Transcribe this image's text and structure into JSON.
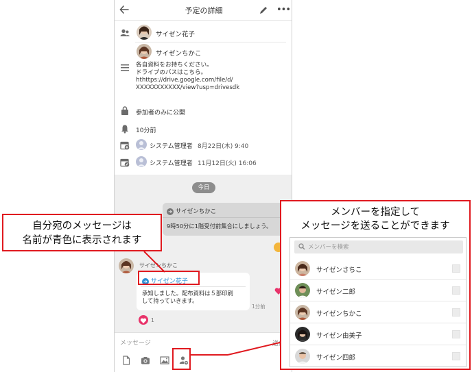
{
  "header": {
    "title": "予定の詳細"
  },
  "participants": [
    {
      "name": "サイゼン花子"
    },
    {
      "name": "サイゼンちかこ"
    }
  ],
  "description": {
    "lines": [
      "各自資料をお持ちください。",
      "ドライブのバスはこちら。",
      " hthttps://drive.google.com/file/d/",
      "XXXXXXXXXXX/view?usp=drivesdk"
    ]
  },
  "visibility": "参加者のみに公開",
  "reminder": "10分前",
  "created": {
    "user": "システム管理者",
    "date": "8月22日(木) 9:40"
  },
  "updated": {
    "user": "システム管理者",
    "date": "11月12日(火) 16:06"
  },
  "chat": {
    "day_label": "今日",
    "mine": {
      "to": "サイゼンちかこ",
      "message": "9時50分に1階受付前集合にしましょう。"
    },
    "other": {
      "sender": "サイゼンちかこ",
      "to": "サイゼン花子",
      "message_lines": [
        "承知しました。配布資料は５部印刷",
        "して持っていきます。"
      ],
      "time": "1分前",
      "reaction_count": "1"
    }
  },
  "input": {
    "placeholder": "メッセージ",
    "send_label": "送信"
  },
  "callout_left": {
    "line1": "自分宛のメッセージは",
    "line2": "名前が青色に表示されます"
  },
  "panel": {
    "title_line1": "メンバーを指定して",
    "title_line2": "メッセージを送ることができます",
    "search_placeholder": "メンバーを検索",
    "members": [
      {
        "name": "サイゼンさちこ"
      },
      {
        "name": "サイゼン二郎"
      },
      {
        "name": "サイゼンちかこ"
      },
      {
        "name": "サイゼン由美子"
      },
      {
        "name": "サイゼン四郎"
      }
    ]
  },
  "colors": {
    "callout_border": "#e0191f",
    "mention_blue": "#2a8fd6",
    "heart": "#e8336a",
    "like": "#f3b53c"
  }
}
